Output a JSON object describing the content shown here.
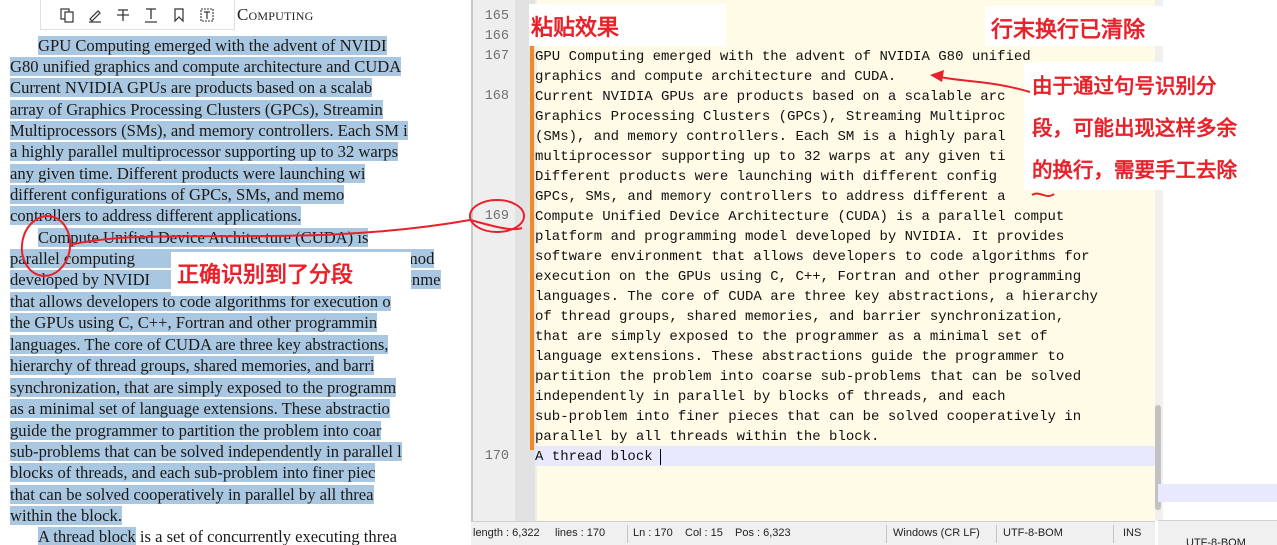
{
  "pdf": {
    "heading": "Computing",
    "toolbar_icons": [
      "copy-icon",
      "highlight-pen-icon",
      "strikethrough-icon",
      "underline-icon",
      "bookmark-icon",
      "text-select-icon"
    ],
    "lines": [
      "GPU Computing emerged with the advent of NVIDI",
      "G80 unified graphics and compute architecture and CUDA",
      "Current NVIDIA GPUs are products based on a scalab",
      "array of Graphics Processing Clusters (GPCs), Streamin",
      "Multiprocessors (SMs), and memory controllers. Each SM i",
      "a highly parallel multiprocessor supporting up to 32 warps",
      "any given time. Different products were launching wi",
      "different configurations of GPCs, SMs, and memo",
      "controllers to address different applications.",
      "Compute Unified Device Architecture (CUDA) is",
      "parallel computing",
      "mod",
      "developed by NVIDI",
      "ronme",
      "that allows developers to code algorithms for execution o",
      "the GPUs using C, C++, Fortran and other programmin",
      "languages. The core of CUDA are three key abstractions,",
      "hierarchy of thread groups, shared memories, and barri",
      "synchronization, that are simply exposed to the programm",
      "as a minimal set of language extensions. These abstractio",
      "guide the programmer to partition the problem into coar",
      "sub-problems that can be solved independently in parallel l",
      "blocks of threads, and each sub-problem into finer piec",
      "that can be solved cooperatively in parallel by all threa",
      "within the block.",
      "A thread block",
      " is a set of concurrently executing threa"
    ]
  },
  "editor": {
    "line_numbers": [
      "165",
      "166",
      "167",
      "168",
      "169",
      "170"
    ],
    "code_lines": [
      "GPU Computing emerged with the advent of NVIDIA G80 unified",
      "graphics and compute architecture and CUDA.",
      "Current NVIDIA GPUs are products based on a scalable arc",
      "Graphics Processing Clusters (GPCs), Streaming Multiproc",
      "(SMs), and memory controllers. Each SM is a highly paral",
      "multiprocessor supporting up to 32 warps at any given ti",
      "Different products were launching with different config",
      "GPCs, SMs, and memory controllers to address different a",
      "Compute Unified Device Architecture (CUDA) is a parallel comput",
      "platform and programming model developed by NVIDIA. It provides",
      "software environment that allows developers to code algorithms for",
      "execution on the GPUs using C, C++, Fortran and other programming",
      "languages. The core of CUDA are three key abstractions, a hierarchy",
      "of thread groups, shared memories, and barrier synchronization,",
      "that are simply exposed to the programmer as a minimal set of",
      "language extensions. These abstractions guide the programmer to",
      "partition the problem into coarse sub-problems that can be solved",
      "independently in parallel by blocks of threads, and each",
      "sub-problem into finer pieces that can be solved cooperatively in",
      "parallel by all threads within the block.",
      "A thread block"
    ]
  },
  "statusbar": {
    "length": "length : 6,322",
    "lines": "lines : 170",
    "ln": "Ln : 170",
    "col": "Col : 15",
    "pos": "Pos : 6,323",
    "eol": "Windows (CR LF)",
    "encoding": "UTF-8-BOM",
    "mode": "INS"
  },
  "second_window": {
    "encoding": "UTF-8-BOM"
  },
  "annotations": {
    "paste_effect": "粘贴效果",
    "eol_cleared": "行末换行已清除",
    "extra_newline": [
      "由于通过句号识别分",
      "段，可能出现这样多余",
      "的换行，需要手工去除"
    ],
    "para_recognized": "正确识别到了分段"
  },
  "colors": {
    "selection_highlight": "#a9c7e0",
    "editor_background": "#fffbe6",
    "change_bar": "#f08a24",
    "annotation_red": "#e8212b",
    "current_line": "#e8e8ff"
  }
}
